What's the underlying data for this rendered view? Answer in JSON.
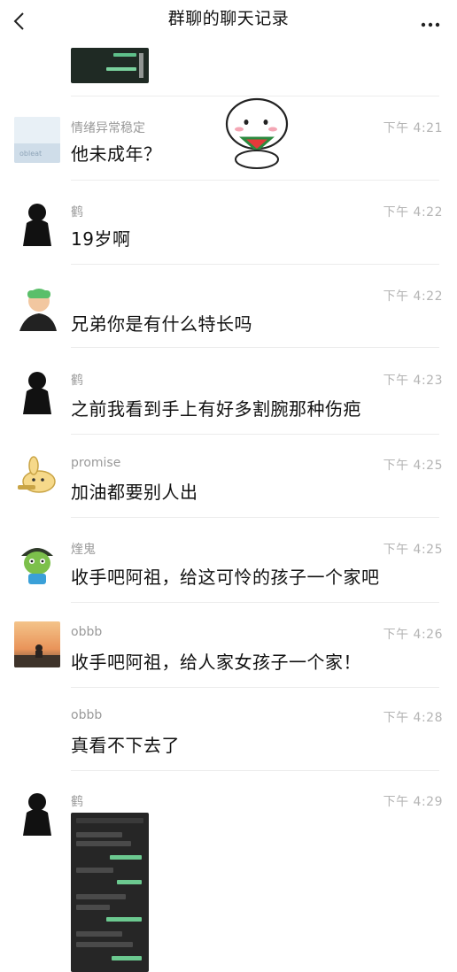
{
  "nav": {
    "title": "群聊的聊天记录",
    "back_icon": "chevron-left-icon",
    "more_icon": "more-horizontal-icon"
  },
  "messages": [
    {
      "sender": "情绪异常稳定",
      "time": "下午 4:21",
      "text": "他未成年？",
      "avatar_text": "obleat"
    },
    {
      "sender": "鹤",
      "time": "下午 4:22",
      "text": "19岁啊"
    },
    {
      "sender": "",
      "time": "下午 4:22",
      "text": "兄弟你是有什么特长吗"
    },
    {
      "sender": "鹤",
      "time": "下午 4:23",
      "text": "之前我看到手上有好多割腕那种伤疤"
    },
    {
      "sender": "promise",
      "time": "下午 4:25",
      "text": "加油都要别人出"
    },
    {
      "sender": "煃鬼",
      "time": "下午 4:25",
      "text": "收手吧阿祖，给这可怜的孩子一个家吧"
    },
    {
      "sender": "obbb",
      "time": "下午 4:26",
      "text": "收手吧阿祖，给人家女孩子一个家！"
    },
    {
      "sender": "obbb",
      "time": "下午 4:28",
      "text": "真看不下去了"
    },
    {
      "sender": "鹤",
      "time": "下午 4:29",
      "text": ""
    }
  ]
}
